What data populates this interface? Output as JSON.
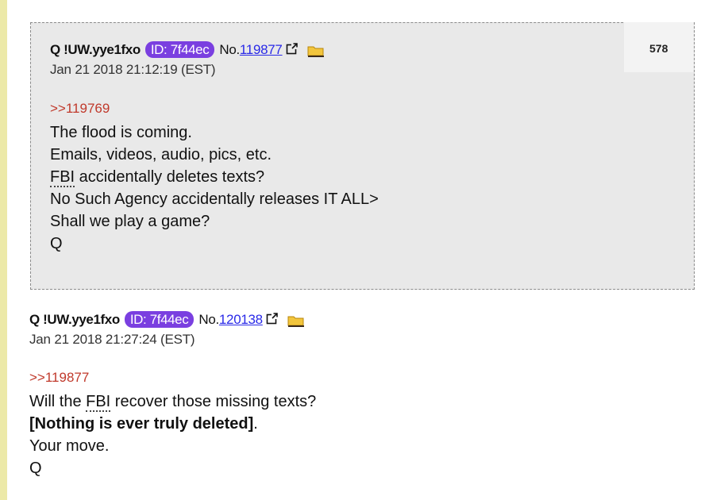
{
  "posts": [
    {
      "tripcode": "Q !UW.yye1fxo",
      "id_label": "ID: 7f44ec",
      "no_label": "No.",
      "post_number": "119877",
      "timestamp": "Jan 21 2018 21:12:19 (EST)",
      "reply_to": ">>119769",
      "reply_count": "578",
      "lines": [
        "The flood is coming.",
        "Emails, videos, audio, pics, etc.",
        {
          "abbr": "FBI",
          "rest": " accidentally deletes texts?"
        },
        "No Such Agency accidentally releases IT ALL>",
        "Shall we play a game?",
        "Q"
      ]
    },
    {
      "tripcode": "Q !UW.yye1fxo",
      "id_label": "ID: 7f44ec",
      "no_label": "No.",
      "post_number": "120138",
      "timestamp": "Jan 21 2018 21:27:24 (EST)",
      "reply_to": ">>119877",
      "lines": [
        {
          "pre": "Will the ",
          "abbr": "FBI",
          "rest": " recover those missing texts?"
        },
        {
          "bold": "[Nothing is ever truly deleted]",
          "rest": "."
        },
        "Your move.",
        "Q"
      ]
    }
  ],
  "colors": {
    "id_badge": "#7a3fe0",
    "reply_link": "#c0392b",
    "post_link": "#2a2ae8",
    "quoted_bg": "#e9e9e9",
    "left_bar": "#ece9a8"
  },
  "icons": [
    "external-link-icon",
    "folder-icon"
  ]
}
